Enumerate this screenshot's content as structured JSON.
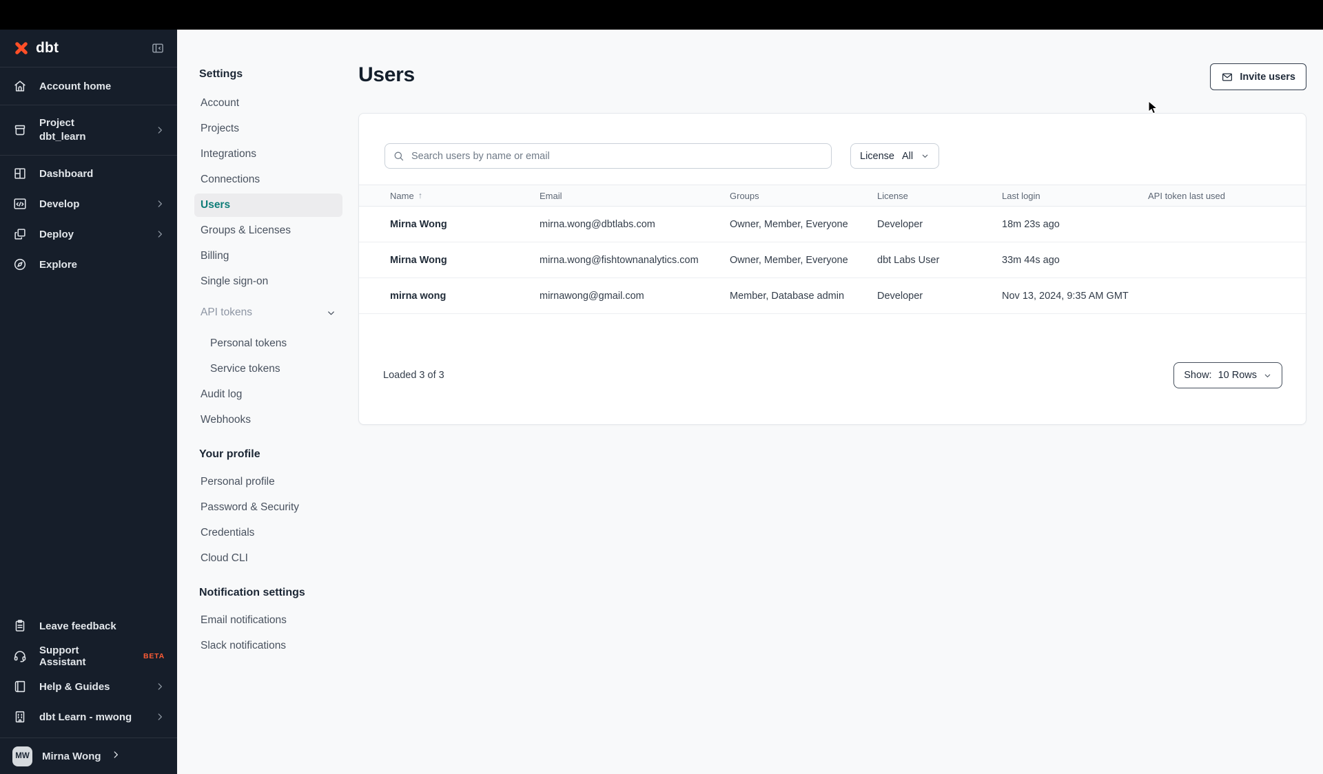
{
  "colors": {
    "accent_teal": "#0E7D78",
    "brand_orange": "#FF4F27",
    "beta_orange": "#FF5C35",
    "sidebar_bg": "#161E2A",
    "topbar_bg": "#000000",
    "page_bg": "#F8F9FA"
  },
  "icons": {
    "sort_asc": "↑"
  },
  "sidebar": {
    "logo_text": "dbt",
    "items": [
      {
        "label": "Account home"
      },
      {
        "label": "Project",
        "sublabel": "dbt_learn"
      },
      {
        "label": "Dashboard"
      },
      {
        "label": "Develop"
      },
      {
        "label": "Deploy"
      },
      {
        "label": "Explore"
      }
    ],
    "footer_items": [
      {
        "label": "Leave feedback"
      },
      {
        "label": "Support Assistant",
        "badge": "BETA"
      },
      {
        "label": "Help & Guides"
      },
      {
        "label": "dbt Learn - mwong"
      }
    ],
    "user": {
      "initials": "MW",
      "name": "Mirna Wong"
    }
  },
  "settings_nav": {
    "title": "Settings",
    "items": [
      "Account",
      "Projects",
      "Integrations",
      "Connections",
      "Users",
      "Groups & Licenses",
      "Billing",
      "Single sign-on"
    ],
    "active_item": "Users",
    "api_tokens_label": "API tokens",
    "api_tokens_children": [
      "Personal tokens",
      "Service tokens"
    ],
    "more_items": [
      "Audit log",
      "Webhooks"
    ],
    "profile_title": "Your profile",
    "profile_items": [
      "Personal profile",
      "Password & Security",
      "Credentials",
      "Cloud CLI"
    ],
    "notifications_title": "Notification settings",
    "notification_items": [
      "Email notifications",
      "Slack notifications"
    ]
  },
  "main": {
    "page_title": "Users",
    "invite_button_label": "Invite users",
    "search_placeholder": "Search users by name or email",
    "license_filter": {
      "label": "License",
      "value": "All"
    },
    "table": {
      "columns": [
        "Name",
        "Email",
        "Groups",
        "License",
        "Last login",
        "API token last used"
      ],
      "rows": [
        {
          "name": "Mirna Wong",
          "email": "mirna.wong@dbtlabs.com",
          "groups": "Owner, Member, Everyone",
          "license": "Developer",
          "last_login": "18m 23s ago",
          "api_token_last_used": ""
        },
        {
          "name": "Mirna Wong",
          "email": "mirna.wong@fishtownanalytics.com",
          "groups": "Owner, Member, Everyone",
          "license": "dbt Labs User",
          "last_login": "33m 44s ago",
          "api_token_last_used": ""
        },
        {
          "name": "mirna wong",
          "email": "mirnawong@gmail.com",
          "groups": "Member, Database admin",
          "license": "Developer",
          "last_login": "Nov 13, 2024, 9:35 AM GMT",
          "api_token_last_used": ""
        }
      ],
      "footer": {
        "loaded_text": "Loaded 3 of 3",
        "show_label": "Show:",
        "show_value": "10 Rows"
      }
    }
  }
}
